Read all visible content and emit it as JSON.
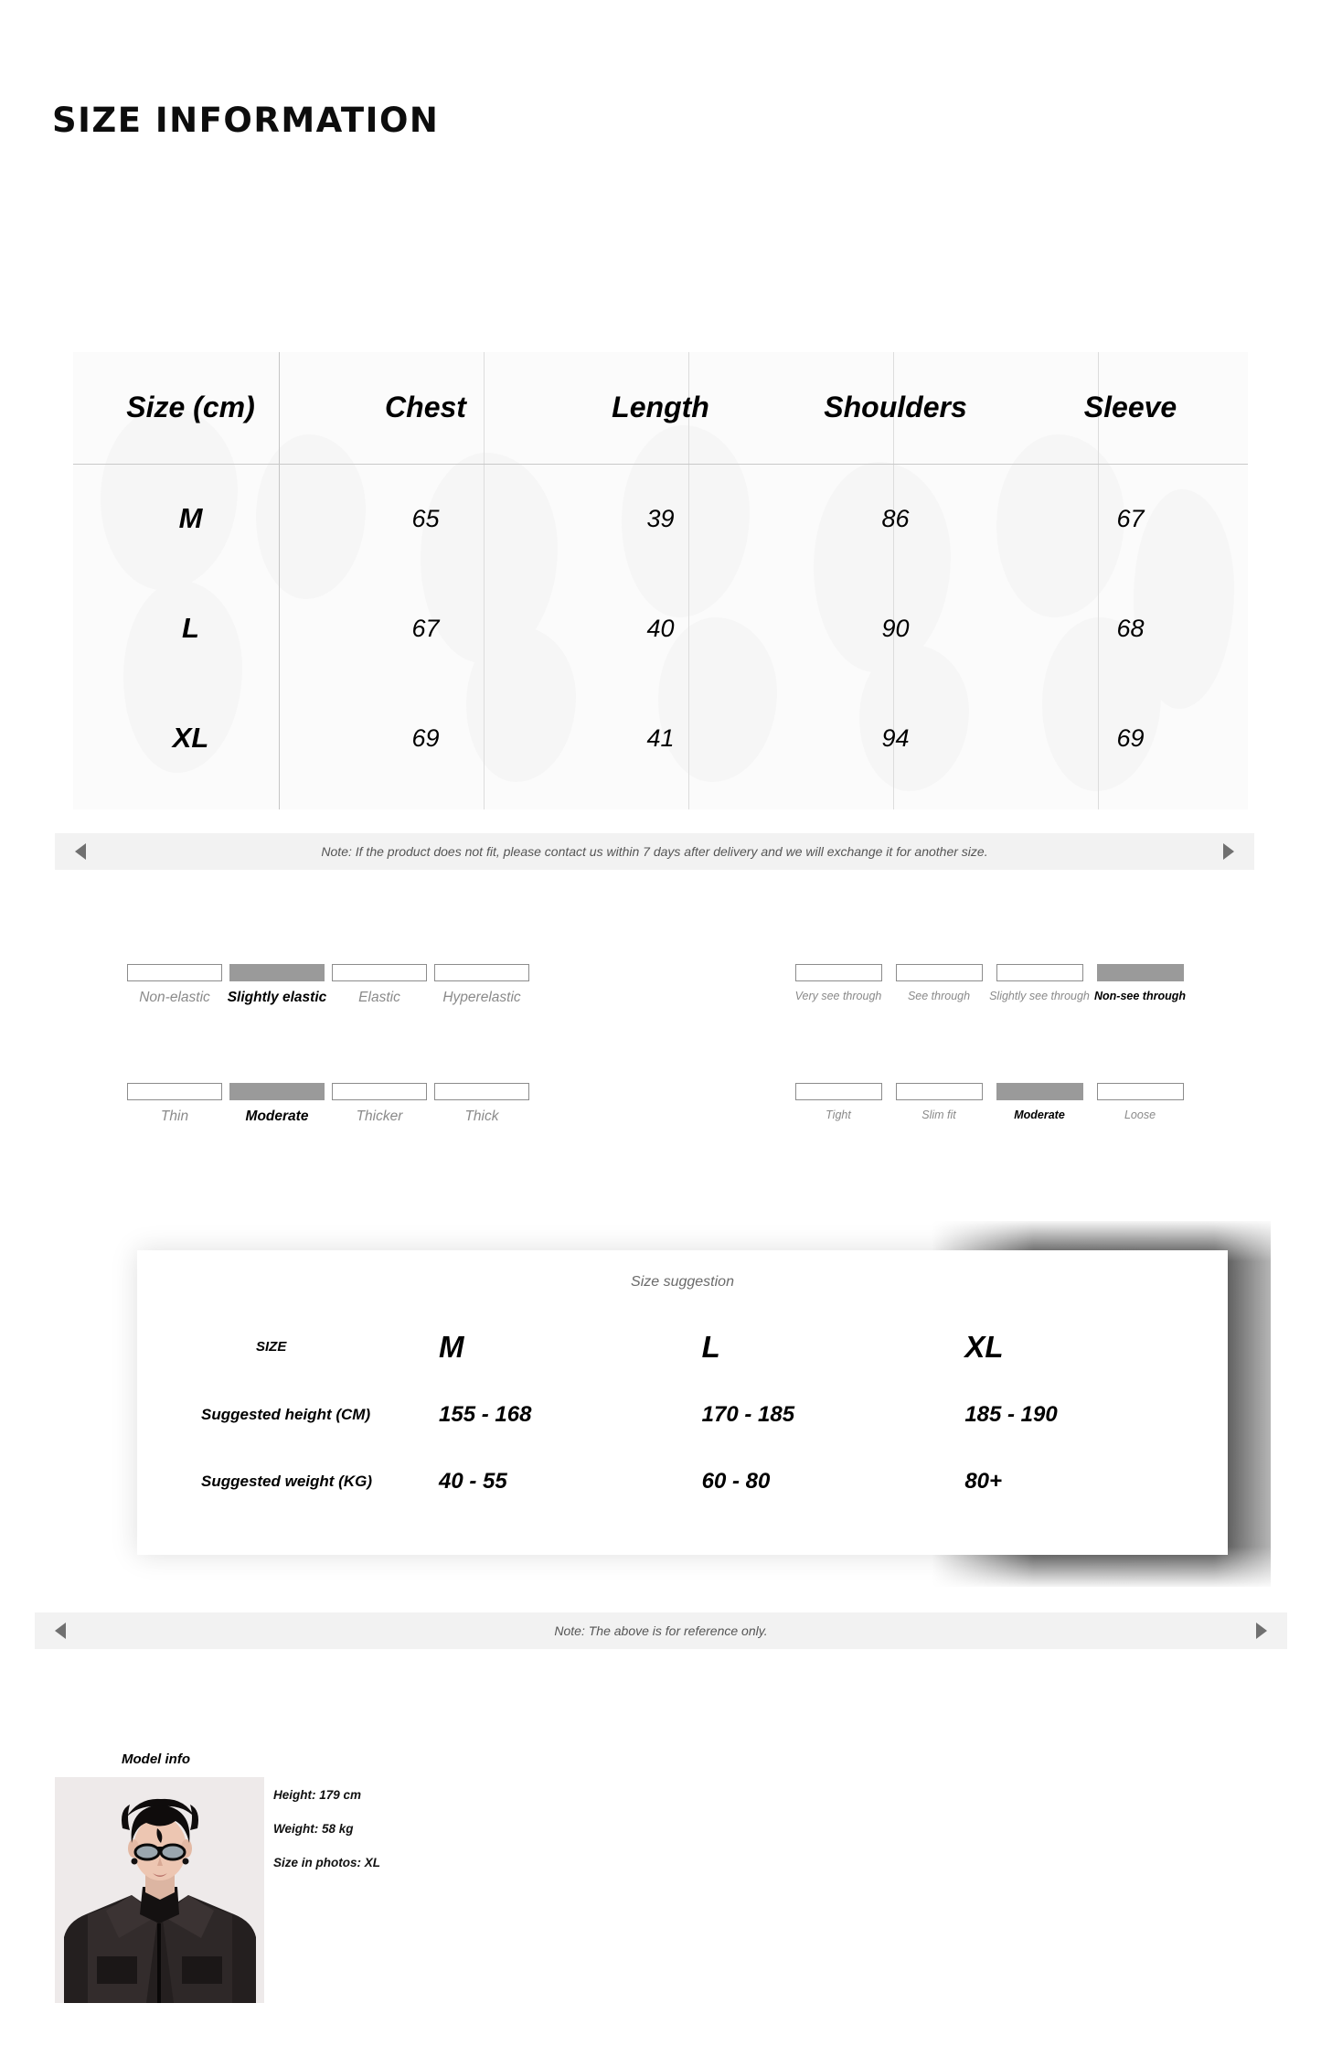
{
  "page": {
    "heading": "SIZE INFORMATION"
  },
  "size_table": {
    "columns": [
      "Size (cm)",
      "Chest",
      "Length",
      "Shoulders",
      "Sleeve"
    ],
    "rows": [
      {
        "size": "M",
        "chest": "65",
        "length": "39",
        "shoulders": "86",
        "sleeve": "67"
      },
      {
        "size": "L",
        "chest": "67",
        "length": "40",
        "shoulders": "90",
        "sleeve": "68"
      },
      {
        "size": "XL",
        "chest": "69",
        "length": "41",
        "shoulders": "94",
        "sleeve": "69"
      }
    ]
  },
  "note_bar_top": {
    "text": "Note: If the product does not fit, please contact us within 7 days after delivery and we will exchange it for another size.",
    "prev_icon": "triangle-left-icon",
    "next_icon": "triangle-right-icon"
  },
  "attributes": {
    "elasticity": {
      "options": [
        "Non-elastic",
        "Slightly elastic",
        "Elastic",
        "Hyperelastic"
      ],
      "selected": "Slightly elastic"
    },
    "transparency": {
      "options": [
        "Very see through",
        "See through",
        "Slightly see through",
        "Non-see through"
      ],
      "selected": "Non-see through"
    },
    "thickness": {
      "options": [
        "Thin",
        "Moderate",
        "Thicker",
        "Thick"
      ],
      "selected": "Moderate"
    },
    "fit": {
      "options": [
        "Tight",
        "Slim fit",
        "Moderate",
        "Loose"
      ],
      "selected": "Moderate"
    }
  },
  "size_suggestion": {
    "title": "Size suggestion",
    "row_labels": [
      "SIZE",
      "Suggested height (CM)",
      "Suggested weight (KG)"
    ],
    "sizes": [
      "M",
      "L",
      "XL"
    ],
    "height": [
      "155 - 168",
      "170 - 185",
      "185 - 190"
    ],
    "weight": [
      "40 - 55",
      "60 - 80",
      "80+"
    ]
  },
  "note_bar_bottom": {
    "text": "Note: The above is for reference only.",
    "prev_icon": "triangle-left-icon",
    "next_icon": "triangle-right-icon"
  },
  "model_info": {
    "title": "Model info",
    "height": "Height: 179 cm",
    "weight": "Weight: 58 kg",
    "size_in_photos": "Size in photos: XL",
    "photo_alt": "model-wearing-black-leather-jacket"
  },
  "colors": {
    "swatch_selected": "#9a9a9a",
    "swatch_border": "#8c8c8c",
    "note_bar_bg": "#f2f2f2",
    "table_bg": "#fbfbfb"
  }
}
